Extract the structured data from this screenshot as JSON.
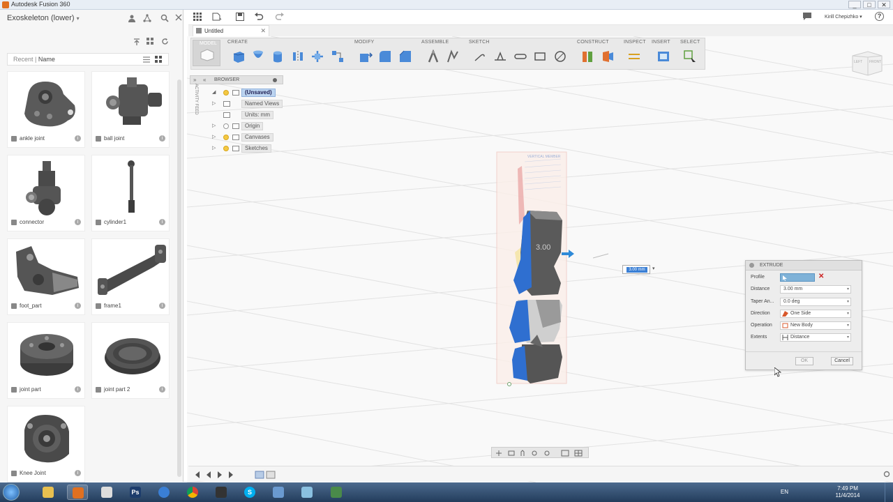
{
  "window": {
    "title": "Autodesk Fusion 360",
    "buttons": [
      "_",
      "□",
      "✕"
    ]
  },
  "left_panel": {
    "project": "Exoskeleton (lower)",
    "recent_label": "Recent",
    "sort_label": "Name",
    "items": [
      {
        "name": "ankle joint",
        "info": "i"
      },
      {
        "name": "ball joint",
        "info": "i"
      },
      {
        "name": "connector",
        "info": "i"
      },
      {
        "name": "cylinder1",
        "info": "i"
      },
      {
        "name": "foot_part",
        "info": "i"
      },
      {
        "name": "frame1",
        "info": "i"
      },
      {
        "name": "joint part",
        "info": "i"
      },
      {
        "name": "joint part 2",
        "info": "i"
      },
      {
        "name": "Knee Joint",
        "info": "i"
      }
    ]
  },
  "top_toolbar": {
    "user": "Kirill Chepizhko ▾",
    "help": "?"
  },
  "doc_tab": {
    "title": "Untitled",
    "close": "✕"
  },
  "ribbon": {
    "workspace": "MODEL",
    "groups": [
      "CREATE",
      "MODIFY",
      "ASSEMBLE",
      "SKETCH",
      "CONSTRUCT",
      "INSPECT",
      "INSERT",
      "SELECT"
    ]
  },
  "browser": {
    "title": "BROWSER",
    "activity_feed": "ACTIVITY FEED",
    "rows": [
      "(Unsaved)",
      "Named Views",
      "Units: mm",
      "Origin",
      "Canvases",
      "Sketches"
    ]
  },
  "viewcube": {
    "left": "LEFT",
    "front": "FRONT"
  },
  "model": {
    "dim_label": "3.00",
    "canvas_title": "VERTICAL MEMBER"
  },
  "distance_input": {
    "value": "3.00 mm"
  },
  "extrude_dialog": {
    "title": "EXTRUDE",
    "fields": {
      "profile_label": "Profile",
      "distance_label": "Distance",
      "distance_value": "3.00 mm",
      "taper_label": "Taper An...",
      "taper_value": "0.0 deg",
      "direction_label": "Direction",
      "direction_value": "One Side",
      "operation_label": "Operation",
      "operation_value": "New Body",
      "extents_label": "Extents",
      "extents_value": "Distance"
    },
    "ok": "OK",
    "cancel": "Cancel"
  },
  "taskbar": {
    "apps": [
      "Explorer",
      "Fusion 360",
      "Tool",
      "Photoshop",
      "Settings",
      "Chrome",
      "Media",
      "Skype",
      "Window",
      "App",
      "Fusion"
    ],
    "photoshop": "Ps",
    "skype": "S",
    "lang": "EN",
    "time": "7:49 PM",
    "date": "11/4/2014"
  },
  "colors": {
    "accent": "#3a7fd5",
    "profile_blue": "#2f6fd0",
    "taskbar": "#2d4a6e"
  }
}
